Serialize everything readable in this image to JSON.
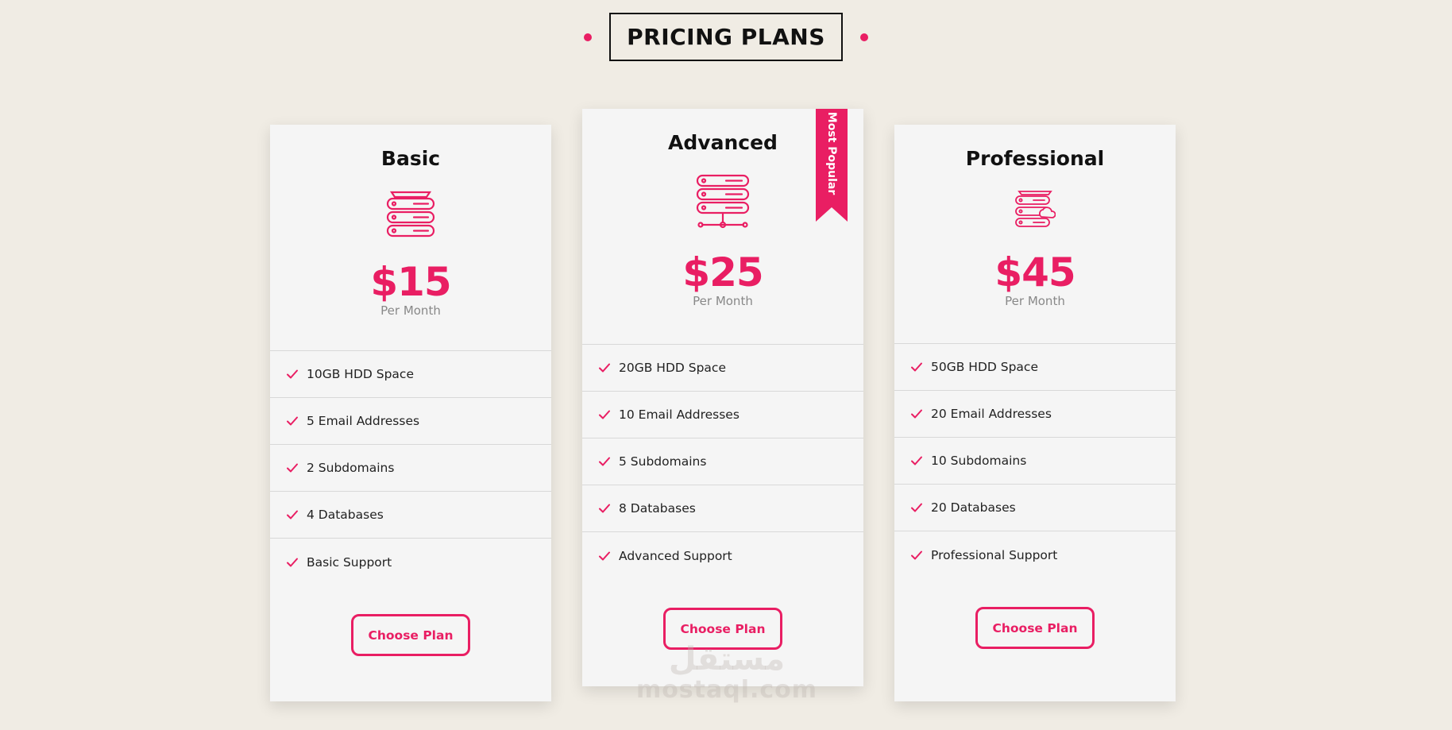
{
  "header": {
    "title": "PRICING PLANS"
  },
  "accent_color": "#e91e63",
  "plans": [
    {
      "name": "Basic",
      "icon": "server-stack-icon",
      "price": "$15",
      "period": "Per Month",
      "features": [
        "10GB HDD Space",
        "5 Email Addresses",
        "2 Subdomains",
        "4 Databases",
        "Basic Support"
      ],
      "button_label": "Choose Plan"
    },
    {
      "name": "Advanced",
      "icon": "server-network-icon",
      "price": "$25",
      "period": "Per Month",
      "badge": "Most Popular",
      "features": [
        "20GB HDD Space",
        "10 Email Addresses",
        "5 Subdomains",
        "8 Databases",
        "Advanced Support"
      ],
      "button_label": "Choose Plan"
    },
    {
      "name": "Professional",
      "icon": "server-cloud-icon",
      "price": "$45",
      "period": "Per Month",
      "features": [
        "50GB HDD Space",
        "20 Email Addresses",
        "10 Subdomains",
        "20 Databases",
        "Professional Support"
      ],
      "button_label": "Choose Plan"
    }
  ],
  "watermark": {
    "logo_text": "مستقل",
    "domain": "mostaql.com"
  }
}
